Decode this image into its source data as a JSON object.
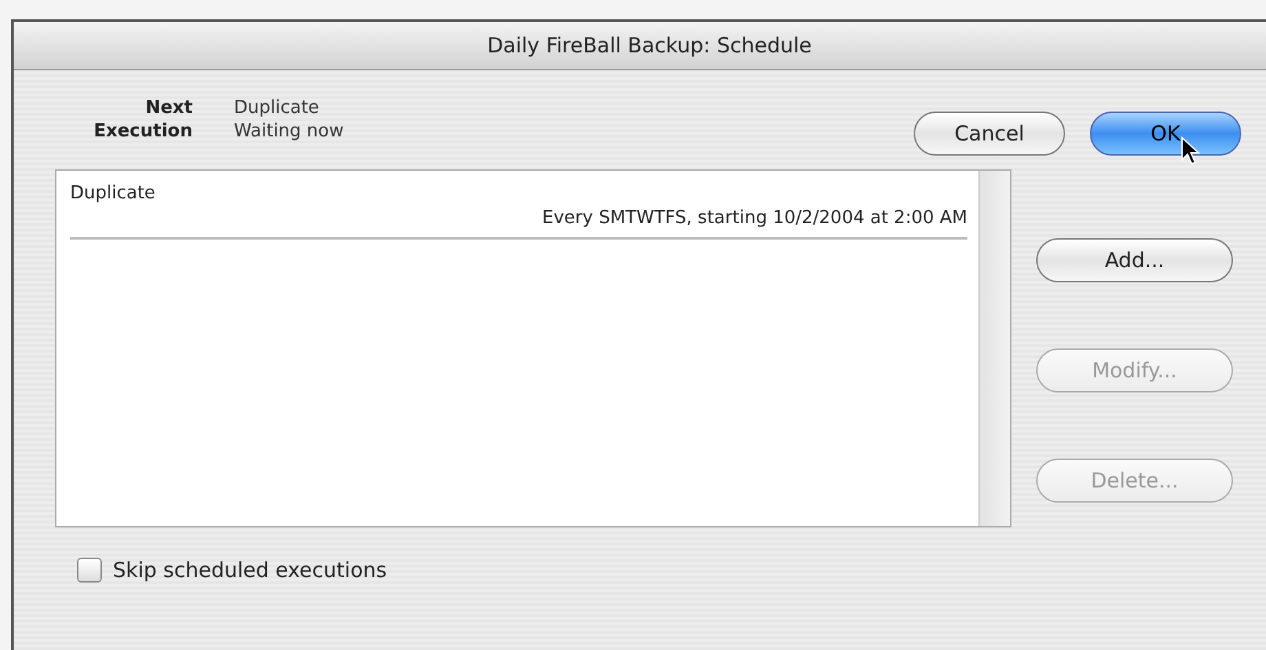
{
  "window": {
    "title": "Daily FireBall Backup: Schedule"
  },
  "next_execution": {
    "label": "Next Execution",
    "lines": [
      "Duplicate",
      "Waiting now"
    ]
  },
  "dialog_buttons": [
    {
      "label": "Cancel",
      "default": false
    },
    {
      "label": "OK",
      "default": true
    }
  ],
  "schedule_list": {
    "rows": [
      {
        "name": "Duplicate",
        "detail": "Every SMTWTFS, starting 10/2/2004 at 2:00 AM"
      }
    ]
  },
  "side_buttons": [
    {
      "label": "Add...",
      "disabled": false
    },
    {
      "label": "Modify...",
      "disabled": true
    },
    {
      "label": "Delete...",
      "disabled": true
    }
  ],
  "skip_checkbox": {
    "label": "Skip scheduled executions",
    "checked": false
  }
}
